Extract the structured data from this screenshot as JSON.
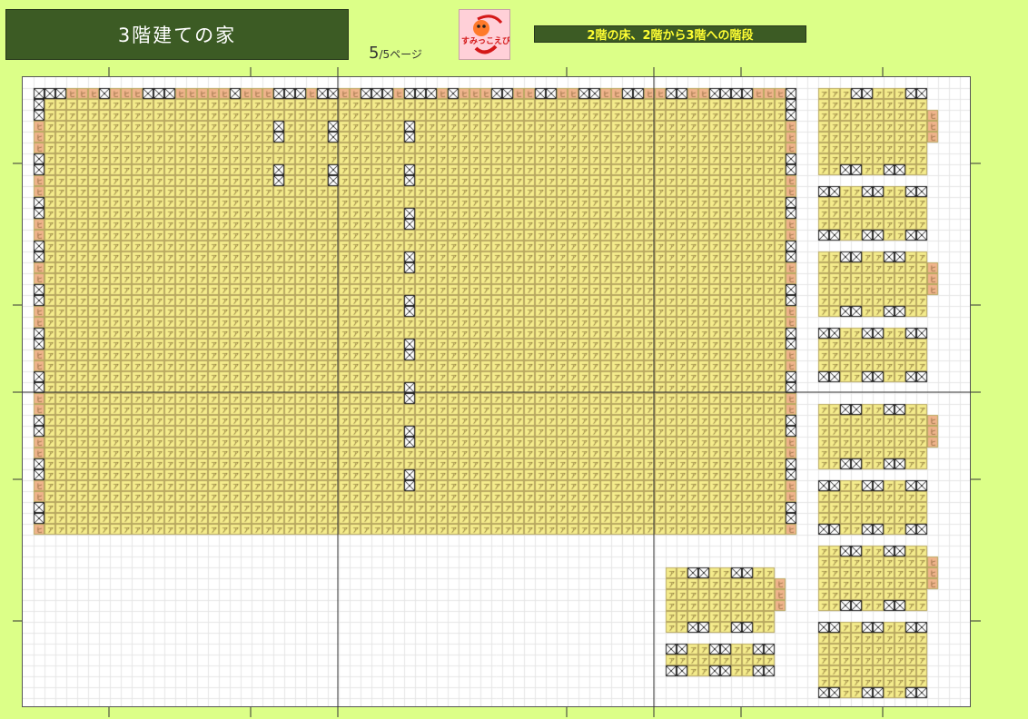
{
  "header": {
    "title": "3階建ての家",
    "page_current": "5",
    "page_total_label": "/5ページ",
    "subtitle": "2階の床、2階から3階への階段"
  },
  "logo": {
    "text": "すみっこえび",
    "icon": "shrimp-icon"
  },
  "pattern": {
    "stitch_glyph": "ア",
    "edge_glyph": "ヒ"
  },
  "colors": {
    "background": "#dcff88",
    "title_bg": "#3c5b24",
    "title_text": "#ffffff",
    "subtitle_text": "#ffff33",
    "fill_cell": "#f5ec8c",
    "edge_cell": "#f0b48c",
    "grid_line": "#e6e6e6"
  }
}
